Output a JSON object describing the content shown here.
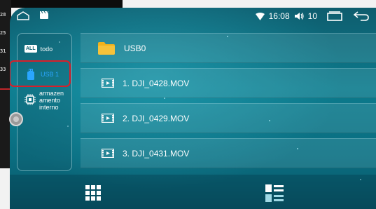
{
  "background": {
    "digits": [
      "28",
      "25",
      "31",
      "33"
    ]
  },
  "statusbar": {
    "time": "16:08",
    "volume": "10",
    "icons": [
      "home-icon",
      "video-clap-icon",
      "wifi-icon",
      "speaker-icon",
      "recent-apps-icon",
      "back-icon"
    ]
  },
  "sidebar": {
    "all_badge": "ALL",
    "items": [
      {
        "label": "todo",
        "icon": "all-icon"
      },
      {
        "label": "USB 1",
        "icon": "usb-icon"
      },
      {
        "label": "armazen\namento\ninterno",
        "icon": "chip-icon"
      }
    ]
  },
  "files": [
    {
      "name": "USB0",
      "type": "folder"
    },
    {
      "name": "1. DJI_0428.MOV",
      "type": "video"
    },
    {
      "name": "2. DJI_0429.MOV",
      "type": "video"
    },
    {
      "name": "3. DJI_0431.MOV",
      "type": "video"
    }
  ],
  "bottombar": {
    "icons": [
      "grid-view-icon",
      "list-view-icon"
    ]
  },
  "colors": {
    "accent": "#2aa6ff",
    "highlight": "#d81f2a",
    "folder": "#f2b21b"
  }
}
